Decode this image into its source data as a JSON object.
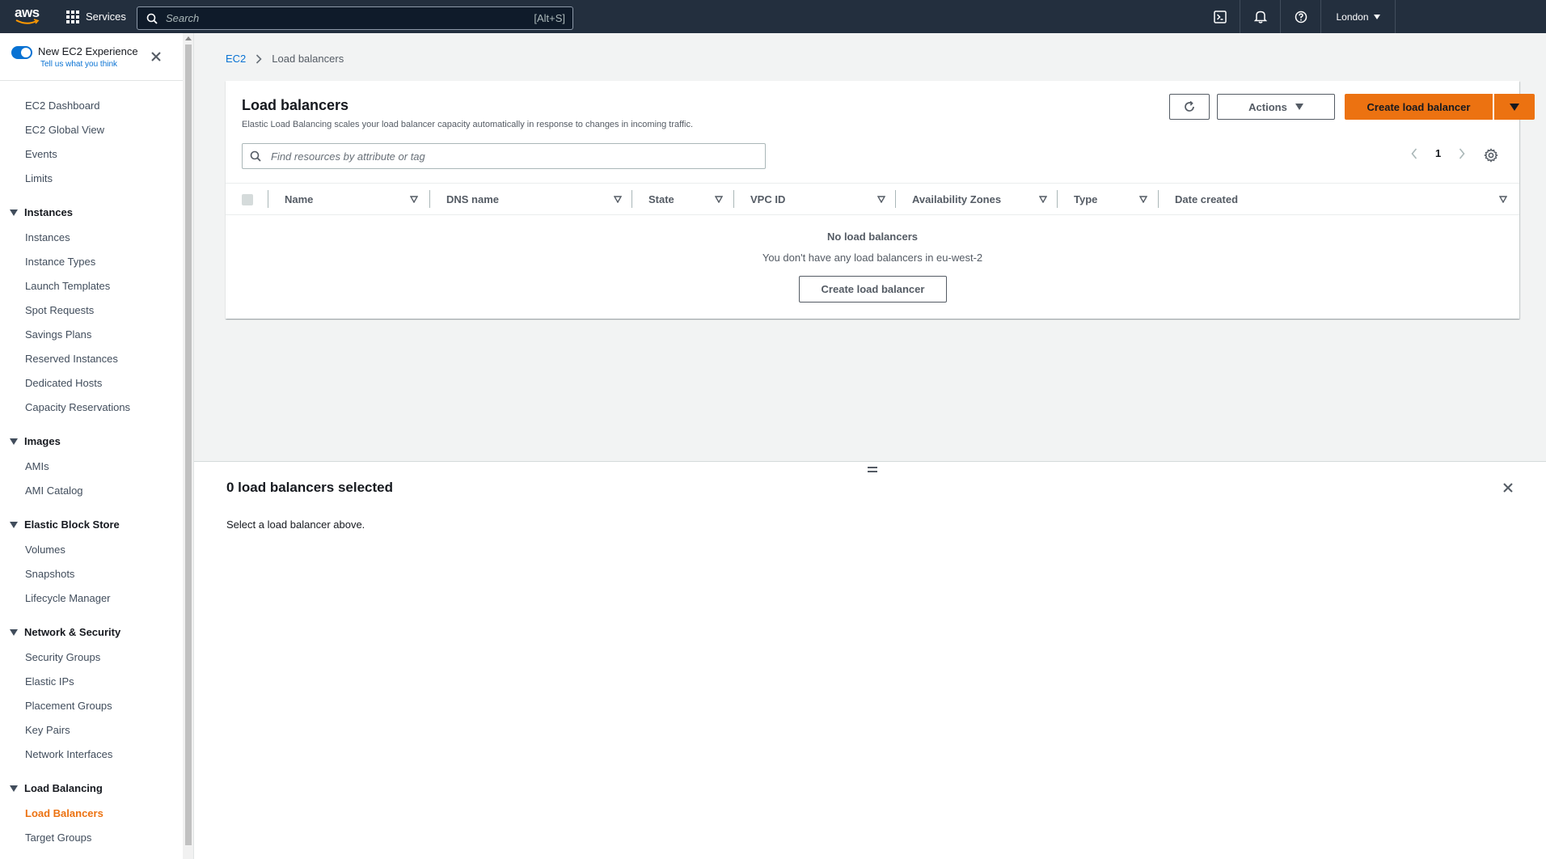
{
  "topnav": {
    "logo_text": "aws",
    "services_label": "Services",
    "search_placeholder": "Search",
    "search_shortcut": "[Alt+S]",
    "region_label": "London"
  },
  "sidebar": {
    "experience_title": "New EC2 Experience",
    "experience_link": "Tell us what you think",
    "top_items": [
      "EC2 Dashboard",
      "EC2 Global View",
      "Events",
      "Limits"
    ],
    "sections": [
      {
        "title": "Instances",
        "items": [
          "Instances",
          "Instance Types",
          "Launch Templates",
          "Spot Requests",
          "Savings Plans",
          "Reserved Instances",
          "Dedicated Hosts",
          "Capacity Reservations"
        ]
      },
      {
        "title": "Images",
        "items": [
          "AMIs",
          "AMI Catalog"
        ]
      },
      {
        "title": "Elastic Block Store",
        "items": [
          "Volumes",
          "Snapshots",
          "Lifecycle Manager"
        ]
      },
      {
        "title": "Network & Security",
        "items": [
          "Security Groups",
          "Elastic IPs",
          "Placement Groups",
          "Key Pairs",
          "Network Interfaces"
        ]
      },
      {
        "title": "Load Balancing",
        "items": [
          "Load Balancers",
          "Target Groups"
        ]
      }
    ],
    "active_item": "Load Balancers"
  },
  "breadcrumb": {
    "root": "EC2",
    "current": "Load balancers"
  },
  "panel": {
    "title": "Load balancers",
    "description": "Elastic Load Balancing scales your load balancer capacity automatically in response to changes in incoming traffic.",
    "actions_label": "Actions",
    "create_label": "Create load balancer",
    "filter_placeholder": "Find resources by attribute or tag",
    "page_number": "1",
    "columns": [
      "Name",
      "DNS name",
      "State",
      "VPC ID",
      "Availability Zones",
      "Type",
      "Date created"
    ],
    "empty_title": "No load balancers",
    "empty_description": "You don't have any load balancers in eu-west-2",
    "empty_button": "Create load balancer"
  },
  "details": {
    "title": "0 load balancers selected",
    "message": "Select a load balancer above."
  },
  "colors": {
    "nav_bg": "#232f3e",
    "primary": "#ec7211",
    "link": "#0972d3"
  }
}
